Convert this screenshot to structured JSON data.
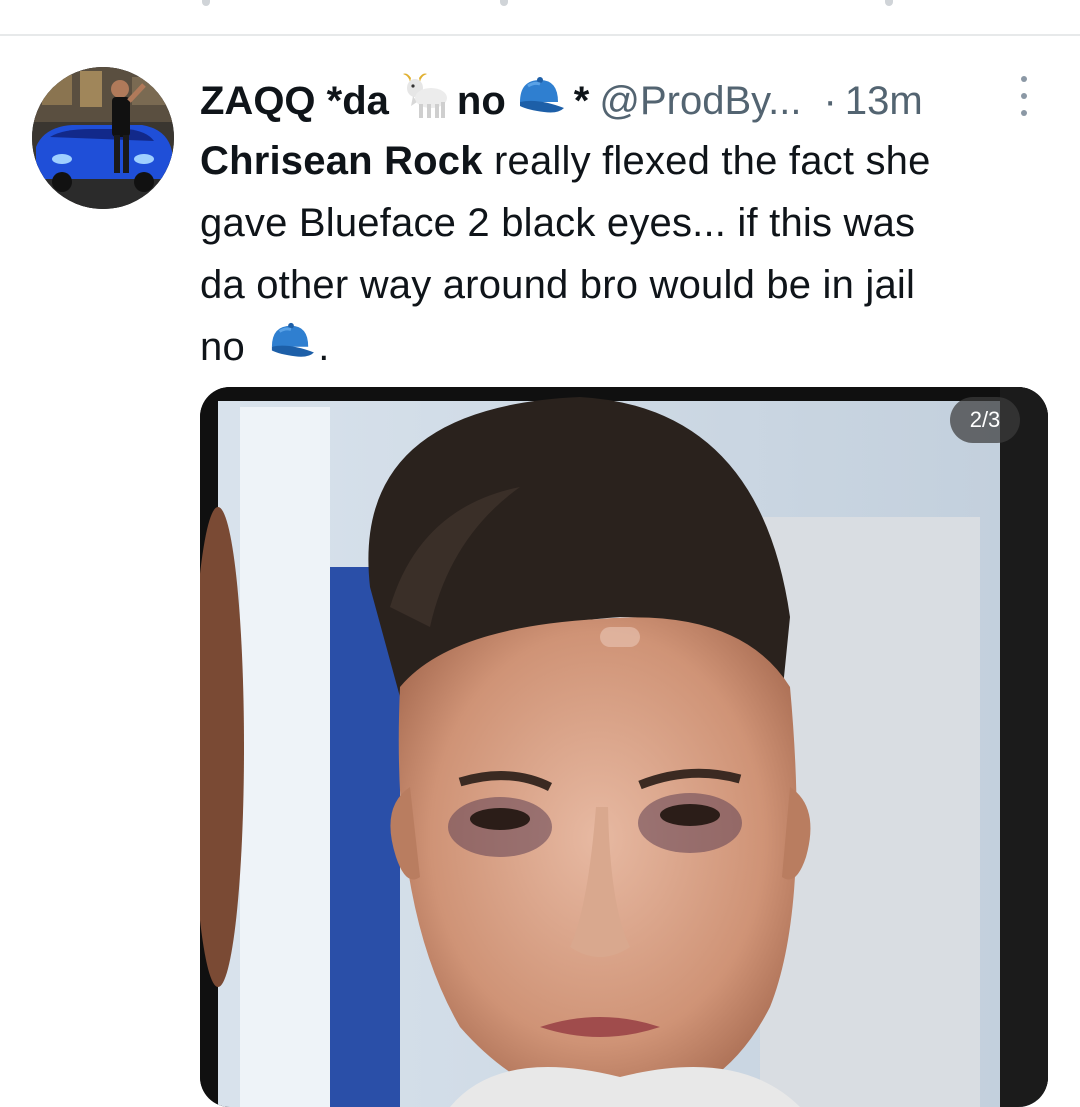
{
  "tweet": {
    "display_name": "ZAQQ *da",
    "name_middle": "no",
    "name_end": "*",
    "handle": "@ProdBy...",
    "separator": "·",
    "time": "13m",
    "text_lines": {
      "mention": "Chrisean Rock",
      "line1_rest": " really flexed the fact she",
      "line2": "gave Blueface 2 black eyes... if this was",
      "line3": "da other way around bro would be in jail",
      "line4_start": "no",
      "line4_end": "."
    },
    "media_counter": "2/3"
  },
  "icons": {
    "goat": "goat-emoji",
    "cap": "blue-cap-emoji",
    "more": "more-vertical-icon"
  },
  "colors": {
    "secondary_text": "#536471",
    "divider": "#e7e9ea",
    "cap_blue": "#2f7fd0"
  }
}
